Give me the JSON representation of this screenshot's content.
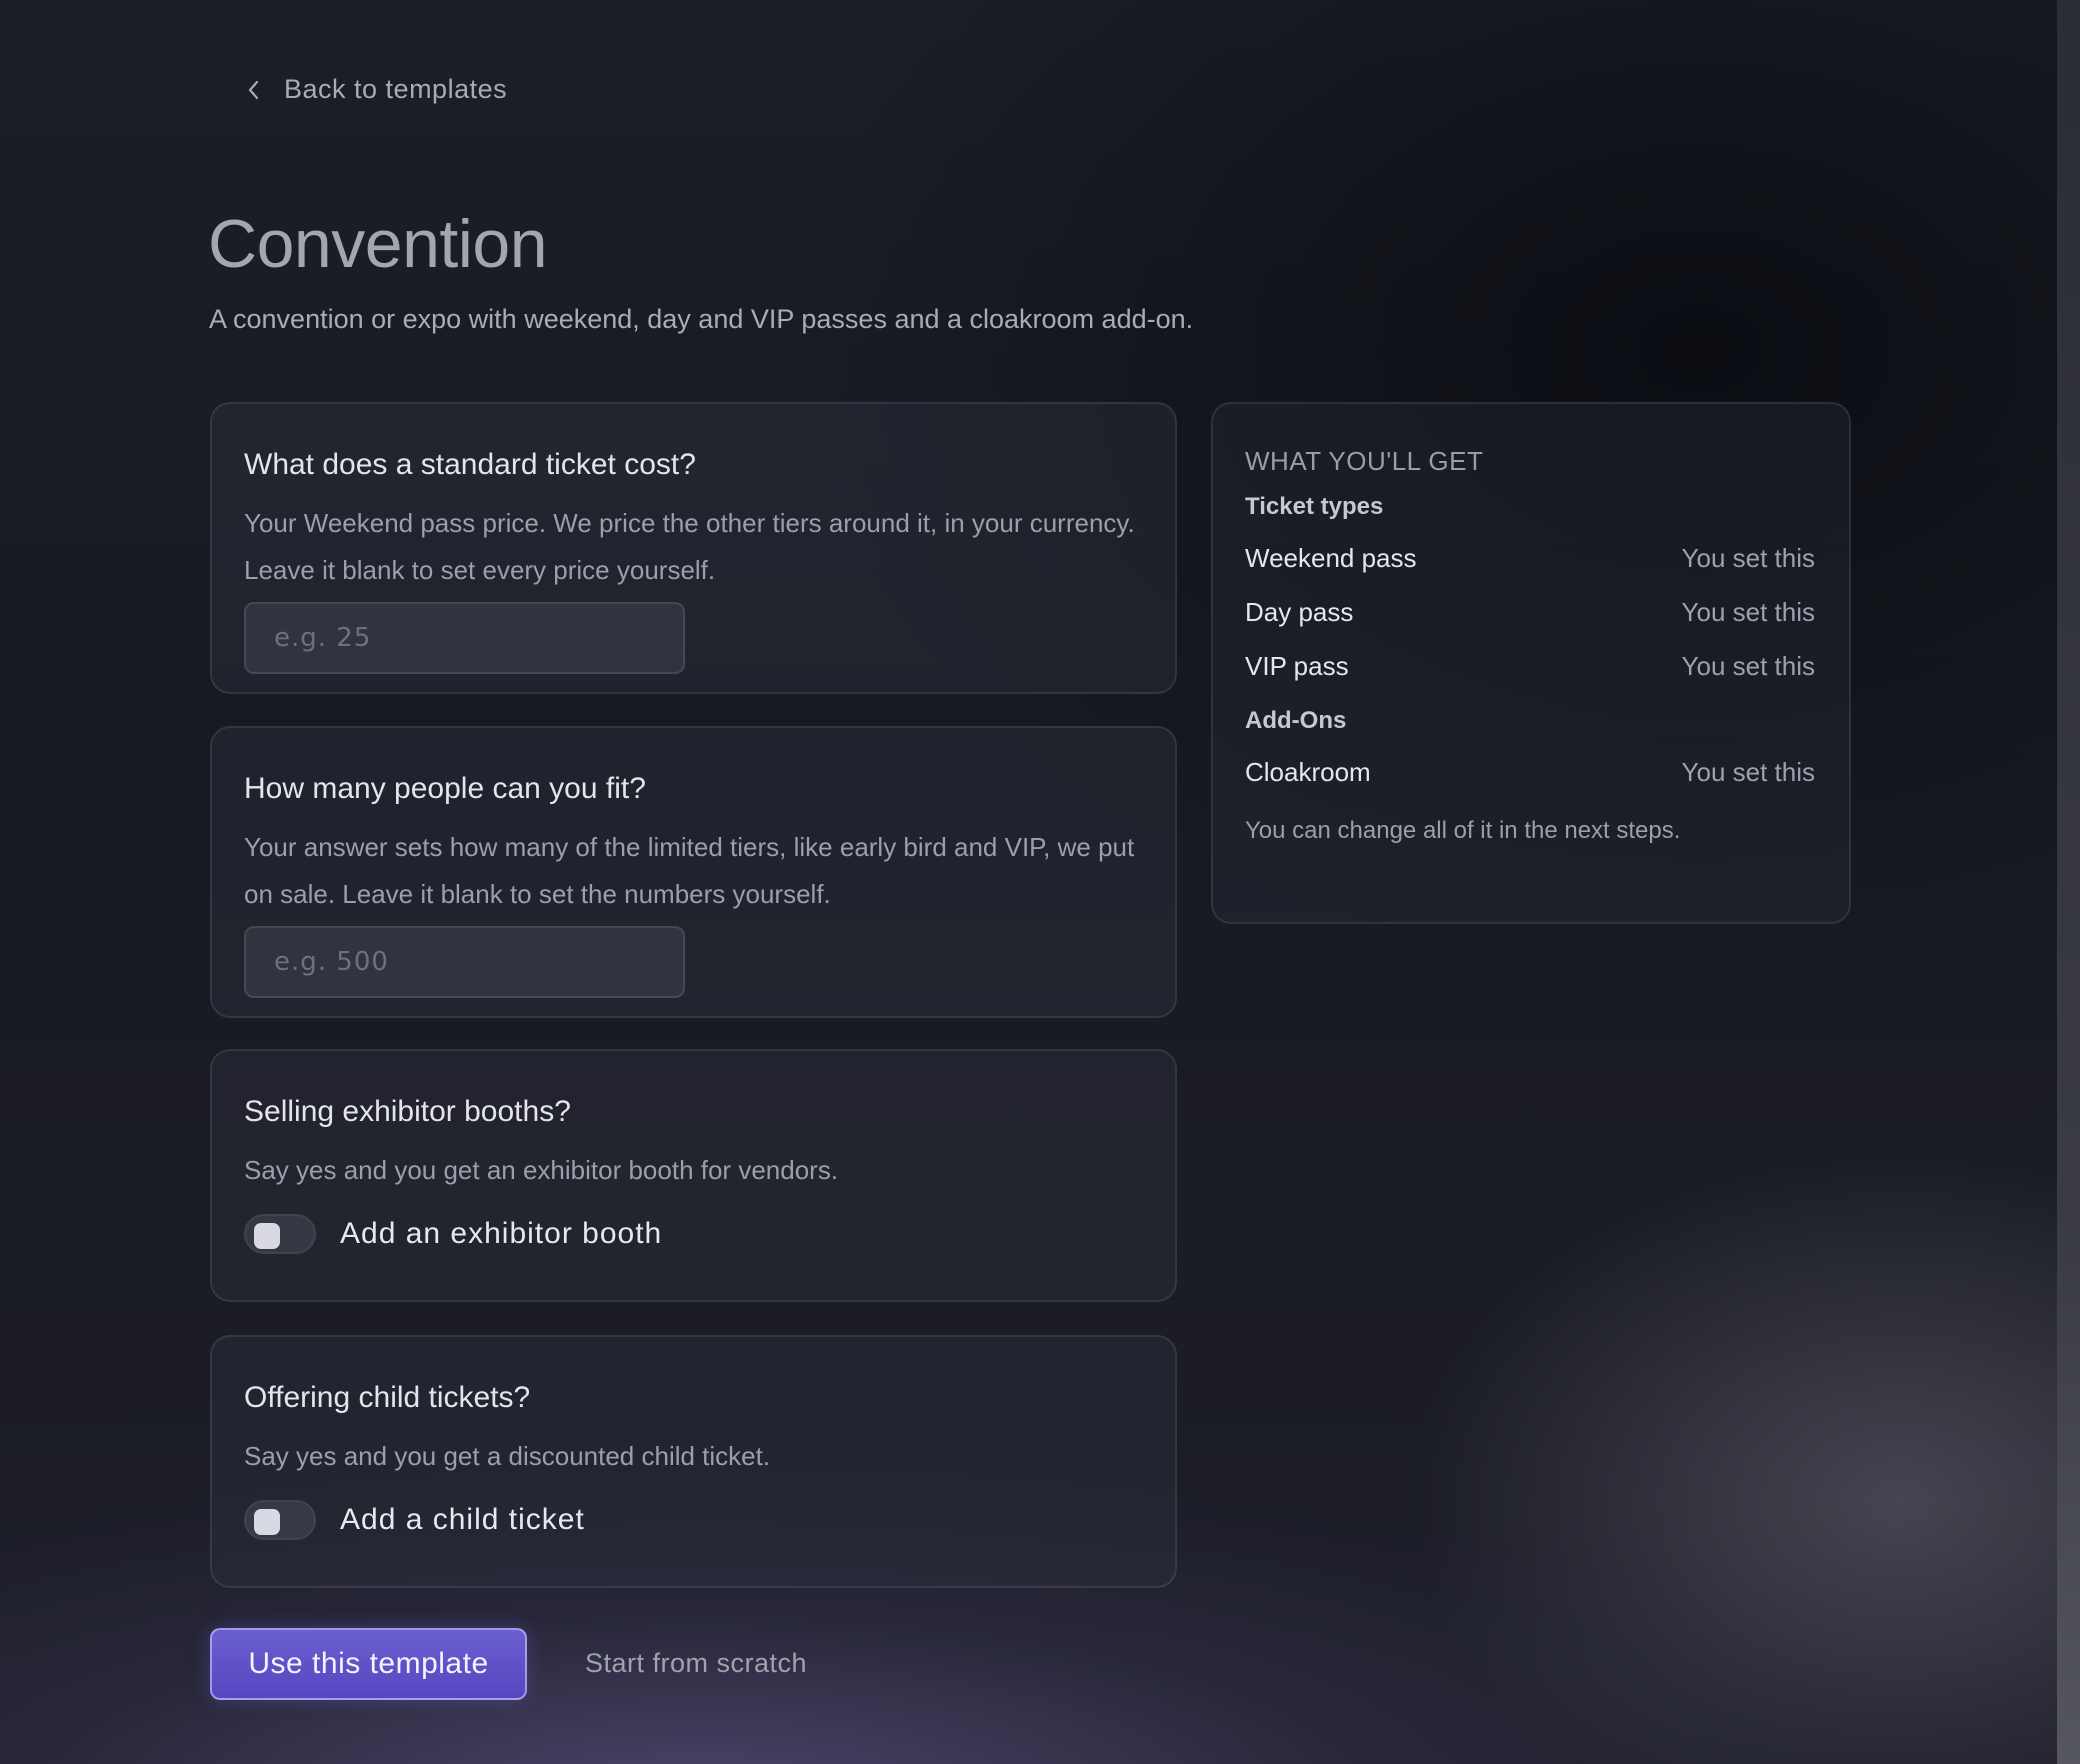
{
  "nav": {
    "back_label": "Back to templates"
  },
  "header": {
    "title": "Convention",
    "subtitle": "A convention or expo with weekend, day and VIP passes and a cloakroom add-on."
  },
  "questions": {
    "price": {
      "title": "What does a standard ticket cost?",
      "description": "Your Weekend pass price. We price the other tiers around it, in your currency. Leave it blank to set every price yourself.",
      "placeholder": "e.g. 25",
      "value": ""
    },
    "capacity": {
      "title": "How many people can you fit?",
      "description": "Your answer sets how many of the limited tiers, like early bird and VIP, we put on sale. Leave it blank to set the numbers yourself.",
      "placeholder": "e.g. 500",
      "value": ""
    },
    "booths": {
      "title": "Selling exhibitor booths?",
      "description": "Say yes and you get an exhibitor booth for vendors.",
      "toggle_label": "Add an exhibitor booth",
      "enabled": false
    },
    "child": {
      "title": "Offering child tickets?",
      "description": "Say yes and you get a discounted child ticket.",
      "toggle_label": "Add a child ticket",
      "enabled": false
    }
  },
  "summary": {
    "heading": "WHAT YOU'LL GET",
    "ticket_types_label": "Ticket types",
    "ticket_types": [
      {
        "name": "Weekend pass",
        "value": "You set this"
      },
      {
        "name": "Day pass",
        "value": "You set this"
      },
      {
        "name": "VIP pass",
        "value": "You set this"
      }
    ],
    "addons_label": "Add-Ons",
    "addons": [
      {
        "name": "Cloakroom",
        "value": "You set this"
      }
    ],
    "note": "You can change all of it in the next steps."
  },
  "actions": {
    "primary_label": "Use this template",
    "secondary_label": "Start from scratch"
  },
  "colors": {
    "accent": "#5c4fc6",
    "background": "#1b1d26"
  }
}
